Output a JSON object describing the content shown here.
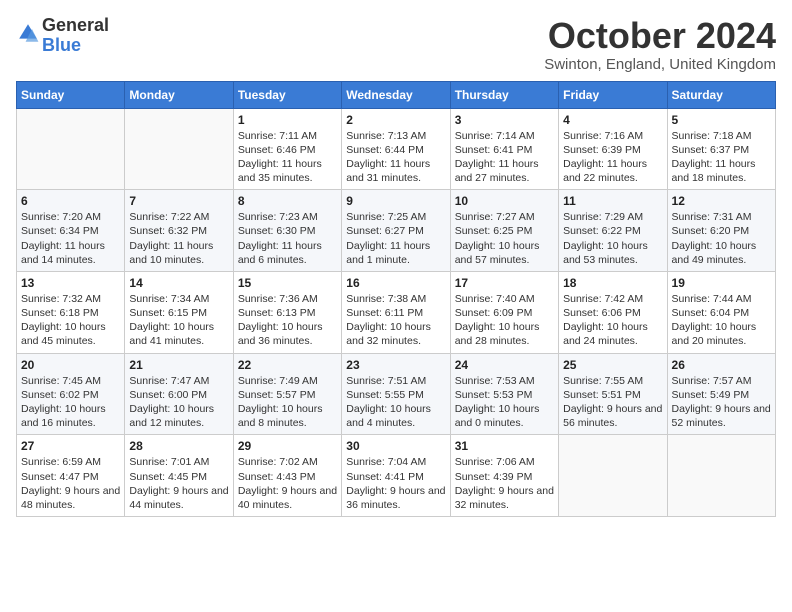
{
  "header": {
    "logo_general": "General",
    "logo_blue": "Blue",
    "month_title": "October 2024",
    "location": "Swinton, England, United Kingdom"
  },
  "days_of_week": [
    "Sunday",
    "Monday",
    "Tuesday",
    "Wednesday",
    "Thursday",
    "Friday",
    "Saturday"
  ],
  "weeks": [
    [
      {
        "day": "",
        "info": ""
      },
      {
        "day": "",
        "info": ""
      },
      {
        "day": "1",
        "info": "Sunrise: 7:11 AM\nSunset: 6:46 PM\nDaylight: 11 hours and 35 minutes."
      },
      {
        "day": "2",
        "info": "Sunrise: 7:13 AM\nSunset: 6:44 PM\nDaylight: 11 hours and 31 minutes."
      },
      {
        "day": "3",
        "info": "Sunrise: 7:14 AM\nSunset: 6:41 PM\nDaylight: 11 hours and 27 minutes."
      },
      {
        "day": "4",
        "info": "Sunrise: 7:16 AM\nSunset: 6:39 PM\nDaylight: 11 hours and 22 minutes."
      },
      {
        "day": "5",
        "info": "Sunrise: 7:18 AM\nSunset: 6:37 PM\nDaylight: 11 hours and 18 minutes."
      }
    ],
    [
      {
        "day": "6",
        "info": "Sunrise: 7:20 AM\nSunset: 6:34 PM\nDaylight: 11 hours and 14 minutes."
      },
      {
        "day": "7",
        "info": "Sunrise: 7:22 AM\nSunset: 6:32 PM\nDaylight: 11 hours and 10 minutes."
      },
      {
        "day": "8",
        "info": "Sunrise: 7:23 AM\nSunset: 6:30 PM\nDaylight: 11 hours and 6 minutes."
      },
      {
        "day": "9",
        "info": "Sunrise: 7:25 AM\nSunset: 6:27 PM\nDaylight: 11 hours and 1 minute."
      },
      {
        "day": "10",
        "info": "Sunrise: 7:27 AM\nSunset: 6:25 PM\nDaylight: 10 hours and 57 minutes."
      },
      {
        "day": "11",
        "info": "Sunrise: 7:29 AM\nSunset: 6:22 PM\nDaylight: 10 hours and 53 minutes."
      },
      {
        "day": "12",
        "info": "Sunrise: 7:31 AM\nSunset: 6:20 PM\nDaylight: 10 hours and 49 minutes."
      }
    ],
    [
      {
        "day": "13",
        "info": "Sunrise: 7:32 AM\nSunset: 6:18 PM\nDaylight: 10 hours and 45 minutes."
      },
      {
        "day": "14",
        "info": "Sunrise: 7:34 AM\nSunset: 6:15 PM\nDaylight: 10 hours and 41 minutes."
      },
      {
        "day": "15",
        "info": "Sunrise: 7:36 AM\nSunset: 6:13 PM\nDaylight: 10 hours and 36 minutes."
      },
      {
        "day": "16",
        "info": "Sunrise: 7:38 AM\nSunset: 6:11 PM\nDaylight: 10 hours and 32 minutes."
      },
      {
        "day": "17",
        "info": "Sunrise: 7:40 AM\nSunset: 6:09 PM\nDaylight: 10 hours and 28 minutes."
      },
      {
        "day": "18",
        "info": "Sunrise: 7:42 AM\nSunset: 6:06 PM\nDaylight: 10 hours and 24 minutes."
      },
      {
        "day": "19",
        "info": "Sunrise: 7:44 AM\nSunset: 6:04 PM\nDaylight: 10 hours and 20 minutes."
      }
    ],
    [
      {
        "day": "20",
        "info": "Sunrise: 7:45 AM\nSunset: 6:02 PM\nDaylight: 10 hours and 16 minutes."
      },
      {
        "day": "21",
        "info": "Sunrise: 7:47 AM\nSunset: 6:00 PM\nDaylight: 10 hours and 12 minutes."
      },
      {
        "day": "22",
        "info": "Sunrise: 7:49 AM\nSunset: 5:57 PM\nDaylight: 10 hours and 8 minutes."
      },
      {
        "day": "23",
        "info": "Sunrise: 7:51 AM\nSunset: 5:55 PM\nDaylight: 10 hours and 4 minutes."
      },
      {
        "day": "24",
        "info": "Sunrise: 7:53 AM\nSunset: 5:53 PM\nDaylight: 10 hours and 0 minutes."
      },
      {
        "day": "25",
        "info": "Sunrise: 7:55 AM\nSunset: 5:51 PM\nDaylight: 9 hours and 56 minutes."
      },
      {
        "day": "26",
        "info": "Sunrise: 7:57 AM\nSunset: 5:49 PM\nDaylight: 9 hours and 52 minutes."
      }
    ],
    [
      {
        "day": "27",
        "info": "Sunrise: 6:59 AM\nSunset: 4:47 PM\nDaylight: 9 hours and 48 minutes."
      },
      {
        "day": "28",
        "info": "Sunrise: 7:01 AM\nSunset: 4:45 PM\nDaylight: 9 hours and 44 minutes."
      },
      {
        "day": "29",
        "info": "Sunrise: 7:02 AM\nSunset: 4:43 PM\nDaylight: 9 hours and 40 minutes."
      },
      {
        "day": "30",
        "info": "Sunrise: 7:04 AM\nSunset: 4:41 PM\nDaylight: 9 hours and 36 minutes."
      },
      {
        "day": "31",
        "info": "Sunrise: 7:06 AM\nSunset: 4:39 PM\nDaylight: 9 hours and 32 minutes."
      },
      {
        "day": "",
        "info": ""
      },
      {
        "day": "",
        "info": ""
      }
    ]
  ]
}
